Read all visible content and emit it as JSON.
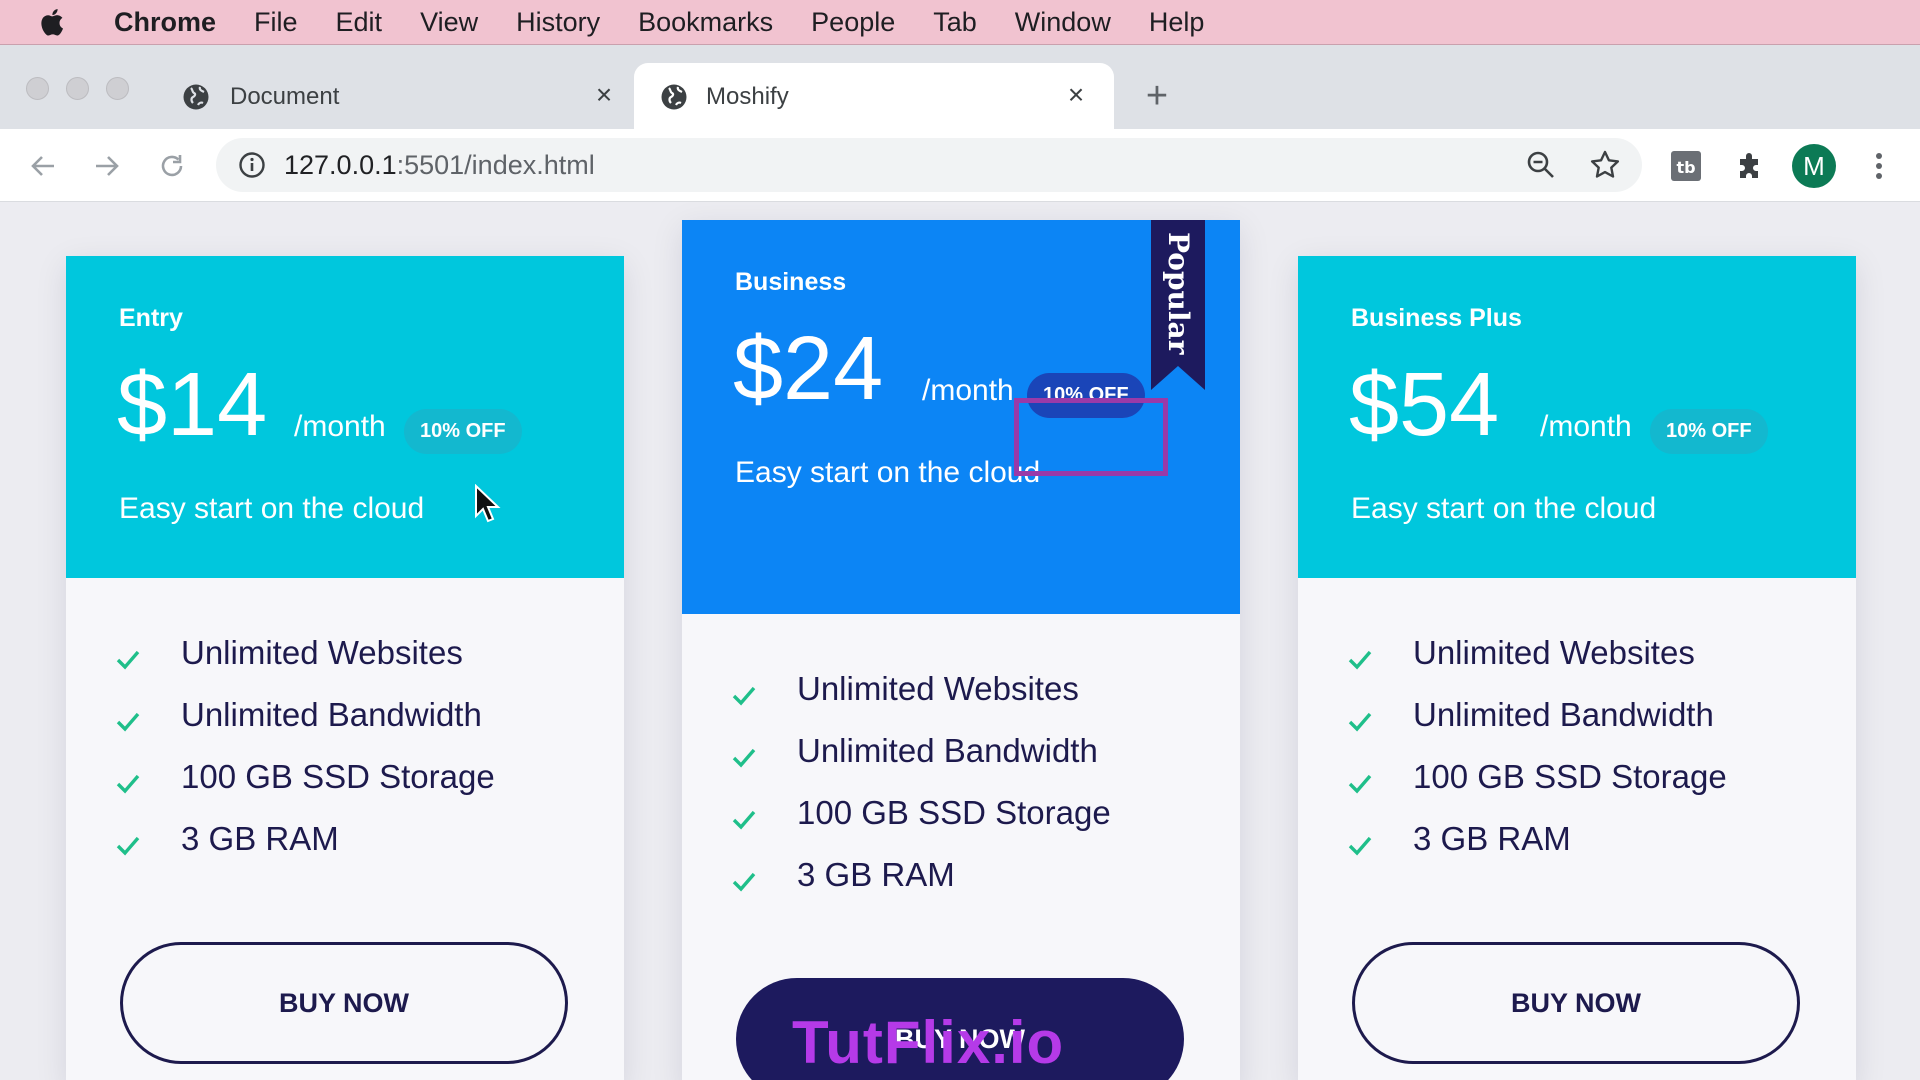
{
  "menubar": {
    "app_name": "Chrome",
    "items": [
      "File",
      "Edit",
      "View",
      "History",
      "Bookmarks",
      "People",
      "Tab",
      "Window",
      "Help"
    ]
  },
  "tabs": [
    {
      "title": "Document",
      "icon": "globe-icon",
      "active": false
    },
    {
      "title": "Moshify",
      "icon": "globe-icon",
      "active": true
    }
  ],
  "toolbar": {
    "url_host": "127.0.0.1",
    "url_path": ":5501/index.html",
    "avatar_letter": "M"
  },
  "plans": [
    {
      "name": "Entry",
      "price": "$14",
      "period": "/month",
      "discount": "10% OFF",
      "tagline": "Easy start on the cloud",
      "features": [
        "Unlimited Websites",
        "Unlimited Bandwidth",
        "100 GB SSD Storage",
        "3 GB RAM"
      ],
      "button": "BUY NOW"
    },
    {
      "name": "Business",
      "price": "$24",
      "period": "/month",
      "discount": "10% OFF",
      "tagline": "Easy start on the cloud",
      "features": [
        "Unlimited Websites",
        "Unlimited Bandwidth",
        "100 GB SSD Storage",
        "3 GB RAM"
      ],
      "button": "BUY NOW",
      "ribbon": "Popular"
    },
    {
      "name": "Business Plus",
      "price": "$54",
      "period": "/month",
      "discount": "10% OFF",
      "tagline": "Easy start on the cloud",
      "features": [
        "Unlimited Websites",
        "Unlimited Bandwidth",
        "100 GB SSD Storage",
        "3 GB RAM"
      ],
      "button": "BUY NOW"
    }
  ],
  "watermark": "TutFlix.io",
  "colors": {
    "cyan_header": "#00c7dd",
    "blue_header": "#0c85f5",
    "navy": "#1d1a5e",
    "check_green": "#1fbf8a",
    "highlight": "#9a3aa8",
    "menubar": "#f1c3d0"
  }
}
